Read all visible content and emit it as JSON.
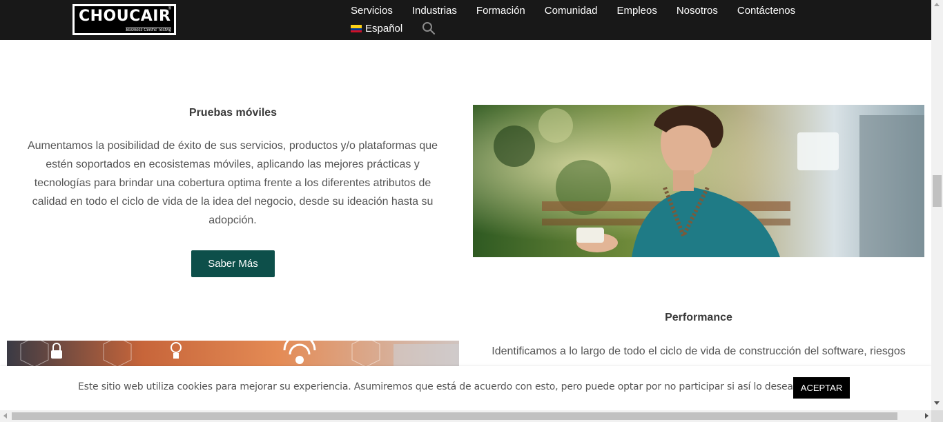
{
  "header": {
    "logo_text": "CHOUCAIR",
    "logo_registered": "®",
    "logo_tagline": "Business Centric Testing",
    "nav": [
      {
        "label": "Servicios"
      },
      {
        "label": "Industrias"
      },
      {
        "label": "Formación"
      },
      {
        "label": "Comunidad"
      },
      {
        "label": "Empleos"
      },
      {
        "label": "Nosotros"
      },
      {
        "label": "Contáctenos"
      }
    ],
    "language": "Español",
    "search_icon": "search-icon",
    "colors": {
      "background": "#181818",
      "text": "#ffffff"
    }
  },
  "sections": {
    "mobile": {
      "title": "Pruebas móviles",
      "description": "Aumentamos la posibilidad de éxito de sus servicios, productos y/o plataformas que estén soportados en ecosistemas móviles, aplicando las mejores prácticas y tecnologías para brindar una cobertura optima frente a los diferentes atributos de calidad en todo el ciclo de vida de la idea del negocio, desde su ideación hasta su adopción.",
      "button_label": "Saber Más",
      "button_color": "#0d4f4a"
    },
    "performance": {
      "title": "Performance",
      "description": "Identificamos a lo largo de todo el ciclo de vida de construcción del software, riesgos"
    }
  },
  "cookie_bar": {
    "message": "Este sitio web utiliza cookies para mejorar su experiencia. Asumiremos que está de acuerdo con esto, pero puede optar por no participar si así lo desea.",
    "accept_label": "ACEPTAR"
  }
}
